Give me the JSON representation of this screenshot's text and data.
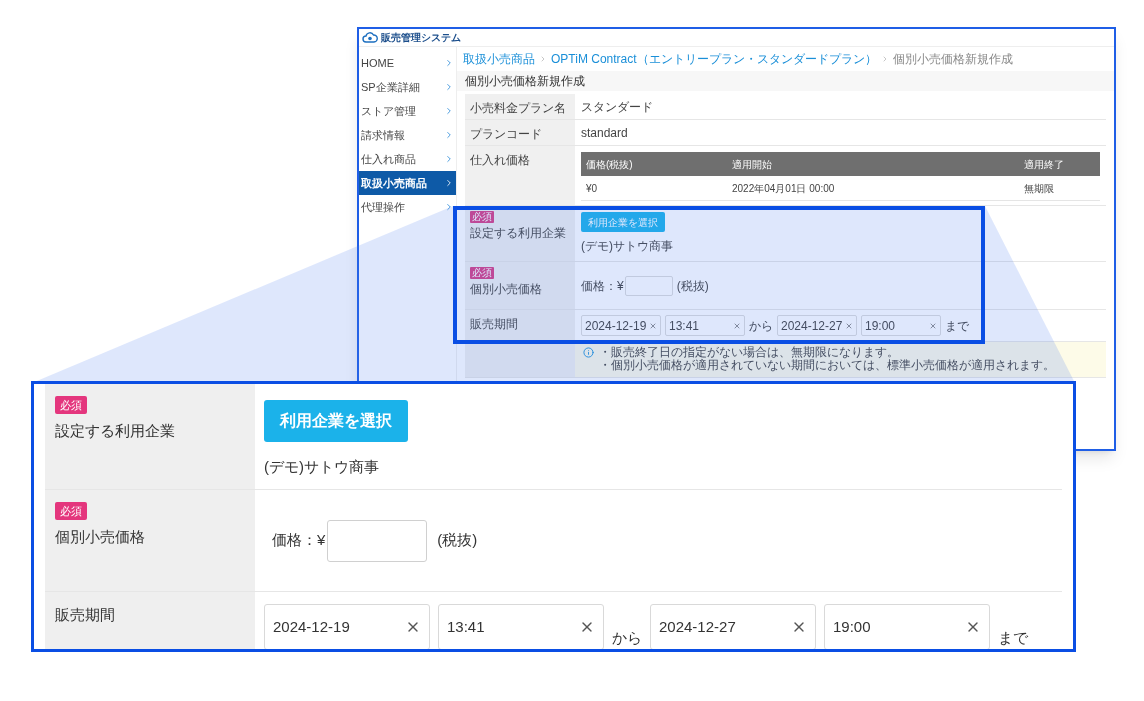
{
  "app": {
    "title": "販売管理システム"
  },
  "sidebar": {
    "items": [
      {
        "label": "HOME",
        "selected": false
      },
      {
        "label": "SP企業詳細",
        "selected": false
      },
      {
        "label": "ストア管理",
        "selected": false
      },
      {
        "label": "請求情報",
        "selected": false
      },
      {
        "label": "仕入れ商品",
        "selected": false
      },
      {
        "label": "取扱小売商品",
        "selected": true
      },
      {
        "label": "代理操作",
        "selected": false
      }
    ]
  },
  "breadcrumb": [
    {
      "label": "取扱小売商品",
      "link": true
    },
    {
      "label": "OPTiM Contract（エントリープラン・スタンダードプラン）",
      "link": true
    },
    {
      "label": "個別小売価格新規作成",
      "link": false
    }
  ],
  "page_title": "個別小売価格新規作成",
  "form": {
    "rows": [
      {
        "kind": "text",
        "label": "小売料金プラン名",
        "value": "スタンダード"
      },
      {
        "kind": "text",
        "label": "プランコード",
        "value": "standard"
      },
      {
        "kind": "table",
        "label": "仕入れ価格",
        "columns": [
          "価格(税抜)",
          "適用開始",
          "適用終了"
        ],
        "rows": [
          [
            "¥0",
            "2022年04月01日 00:00",
            "無期限"
          ]
        ]
      },
      {
        "kind": "company",
        "label": "設定する利用企業",
        "badge": "必須",
        "button": "利用企業を選択",
        "value": "(デモ)サトウ商事"
      },
      {
        "kind": "price",
        "label": "個別小売価格",
        "badge": "必須",
        "prefix": "価格：¥",
        "suffix": "(税抜)"
      },
      {
        "kind": "period",
        "label": "販売期間",
        "fields": [
          {
            "value": "2024-12-19"
          },
          {
            "value": "13:41"
          },
          {
            "value": "2024-12-27"
          },
          {
            "value": "19:00"
          }
        ],
        "between": "から",
        "after": "まで"
      },
      {
        "kind": "note",
        "lines": [
          "・販売終了日の指定がない場合は、無期限になります。",
          "・個別小売価格が適用されていない期間においては、標準小売価格が適用されます。"
        ]
      }
    ]
  },
  "zoom": {
    "rows": [
      {
        "kind": "company",
        "label": "設定する利用企業",
        "badge": "必須",
        "button": "利用企業を選択",
        "value": "(デモ)サトウ商事"
      },
      {
        "kind": "price",
        "label": "個別小売価格",
        "badge": "必須",
        "prefix": "価格：¥",
        "suffix": "(税抜)"
      },
      {
        "kind": "period",
        "label": "販売期間",
        "fields": [
          {
            "value": "2024-12-19"
          },
          {
            "value": "13:41"
          },
          {
            "value": "2024-12-27"
          },
          {
            "value": "19:00"
          }
        ],
        "between": "から",
        "after": "まで"
      }
    ]
  }
}
